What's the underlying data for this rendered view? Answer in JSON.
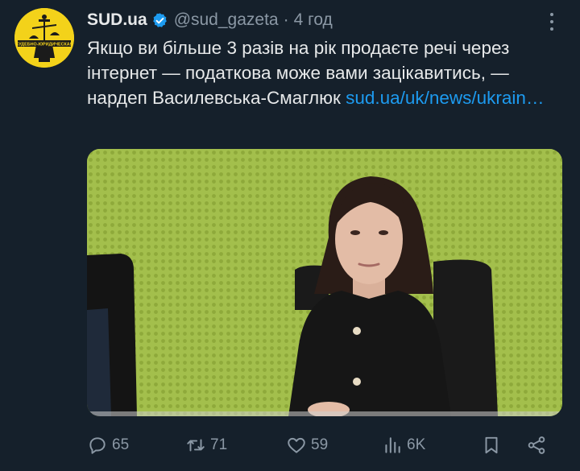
{
  "tweet": {
    "author_name": "SUD.ua",
    "handle": "@sud_gazeta",
    "separator": "·",
    "time": "4 год",
    "text_body": "Якщо ви більше 3 разів на рік продаєте речі через інтернет — податкова може вами зацікавитись, — нардеп Василевська-Смаглюк ",
    "link_text": "sud.ua/uk/news/ukrain…",
    "avatar_text": "СУДЕБНО-ЮРИДИЧЕСКАЯ"
  },
  "actions": {
    "replies": "65",
    "reposts": "71",
    "likes": "59",
    "views": "6K"
  },
  "colors": {
    "background": "#15202b",
    "link": "#1d9bf0",
    "muted": "#8b98a5",
    "verified": "#1d9bf0",
    "avatar_bg": "#f3d21a"
  },
  "icons": [
    "more-icon",
    "verified-icon",
    "reply-icon",
    "repost-icon",
    "like-icon",
    "views-icon",
    "bookmark-icon",
    "share-icon"
  ]
}
